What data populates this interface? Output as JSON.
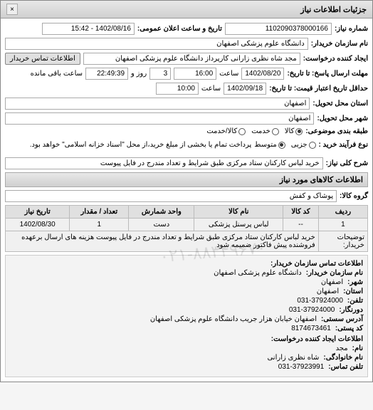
{
  "window": {
    "title": "جزئیات اطلاعات نیاز",
    "close": "×"
  },
  "header": {
    "request_no_label": "شماره نیاز:",
    "request_no": "1102090378000166",
    "public_date_label": "تاریخ و ساعت اعلان عمومی:",
    "public_date": "1402/08/16 - 15:42",
    "buyer_label": "نام سازمان خریدار:",
    "buyer": "دانشگاه علوم پزشکی اصفهان",
    "creator_label": "ایجاد کننده درخواست:",
    "creator": "مجد شاه نظری زارانی کارپرداز دانشگاه علوم پزشکی اصفهان",
    "contact_btn": "اطلاعات تماس خریدار"
  },
  "deadline": {
    "label": "مهلت ارسال پاسخ: تا تاریخ:",
    "date": "1402/08/20",
    "time_label": "ساعت",
    "time": "16:00",
    "remain_days": "3",
    "remain_label": "روز و",
    "remain_time": "22:49:39",
    "remain_suffix": "ساعت باقی مانده"
  },
  "validity": {
    "label": "حداقل تاریخ اعتبار قیمت: تا تاریخ:",
    "date": "1402/09/18",
    "time_label": "ساعت",
    "time": "10:00"
  },
  "location": {
    "province_label": "استان محل تحویل:",
    "province": "اصفهان",
    "city_label": "شهر محل تحویل:",
    "city": "اصفهان"
  },
  "budget": {
    "label": "طبقه بندی موضوعی:",
    "options": [
      "کالا",
      "خدمت",
      "کالا/خدمت"
    ],
    "selected": 0
  },
  "purchase_type": {
    "label": "نوع فرآیند خرید :",
    "options": [
      "جزیی",
      "متوسط"
    ],
    "selected": 1,
    "note": "پرداخت تمام یا بخشی از مبلغ خرید،از محل \"اسناد خزانه اسلامی\" خواهد بود."
  },
  "need": {
    "title_label": "شرح کلی نیاز:",
    "title": "خرید لباس کارکنان ستاد مرکزی طبق شرایط و تعداد مندرج در فایل پیوست"
  },
  "goods_section": "اطلاعات کالاهای مورد نیاز",
  "category": {
    "label": "گروه کالا:",
    "value": "پوشاک و کفش"
  },
  "table": {
    "headers": [
      "ردیف",
      "کد کالا",
      "نام کالا",
      "واحد شمارش",
      "تعداد / مقدار",
      "تاریخ نیاز"
    ],
    "rows": [
      [
        "1",
        "--",
        "لباس پرسنل پزشکی",
        "دست",
        "1",
        "1402/08/30"
      ]
    ],
    "desc_label": "توضیحات خریدار:",
    "desc": "خرید لباس کارکنان ستاد مرکزی طبق شرایط و تعداد مندرج در فایل پیوست هزینه های ارسال برعهده فروشنده پیش فاکتور ضمیمه شود"
  },
  "contact": {
    "header": "اطلاعات تماس سازمان خریدار:",
    "org_label": "نام سازمان خریدار:",
    "org": "دانشگاه علوم پزشکی اصفهان",
    "city_label": "شهر:",
    "city": "اصفهان",
    "province_label": "استان:",
    "province": "اصفهان",
    "tel_label": "تلفن:",
    "tel": "031-37924000",
    "fax_label": "دورنگار:",
    "fax": "031-37924000",
    "address_label": "آدرس سستی:",
    "address": "اصفهان خیابان هزار جریب دانشگاه علوم پزشکی اصفهان",
    "postal_label": "کد پستی:",
    "postal": "8174673461",
    "creator_header": "اطلاعات ایجاد کننده درخواست:",
    "name_label": "نام:",
    "name": "مجد",
    "family_label": "نام خانوادگی:",
    "family": "شاه نظری زارانی",
    "creator_tel_label": "تلفن تماس:",
    "creator_tel": "031-37923991"
  },
  "watermark": "۰۲۱-۸۸۳۴۹۶۷۰"
}
